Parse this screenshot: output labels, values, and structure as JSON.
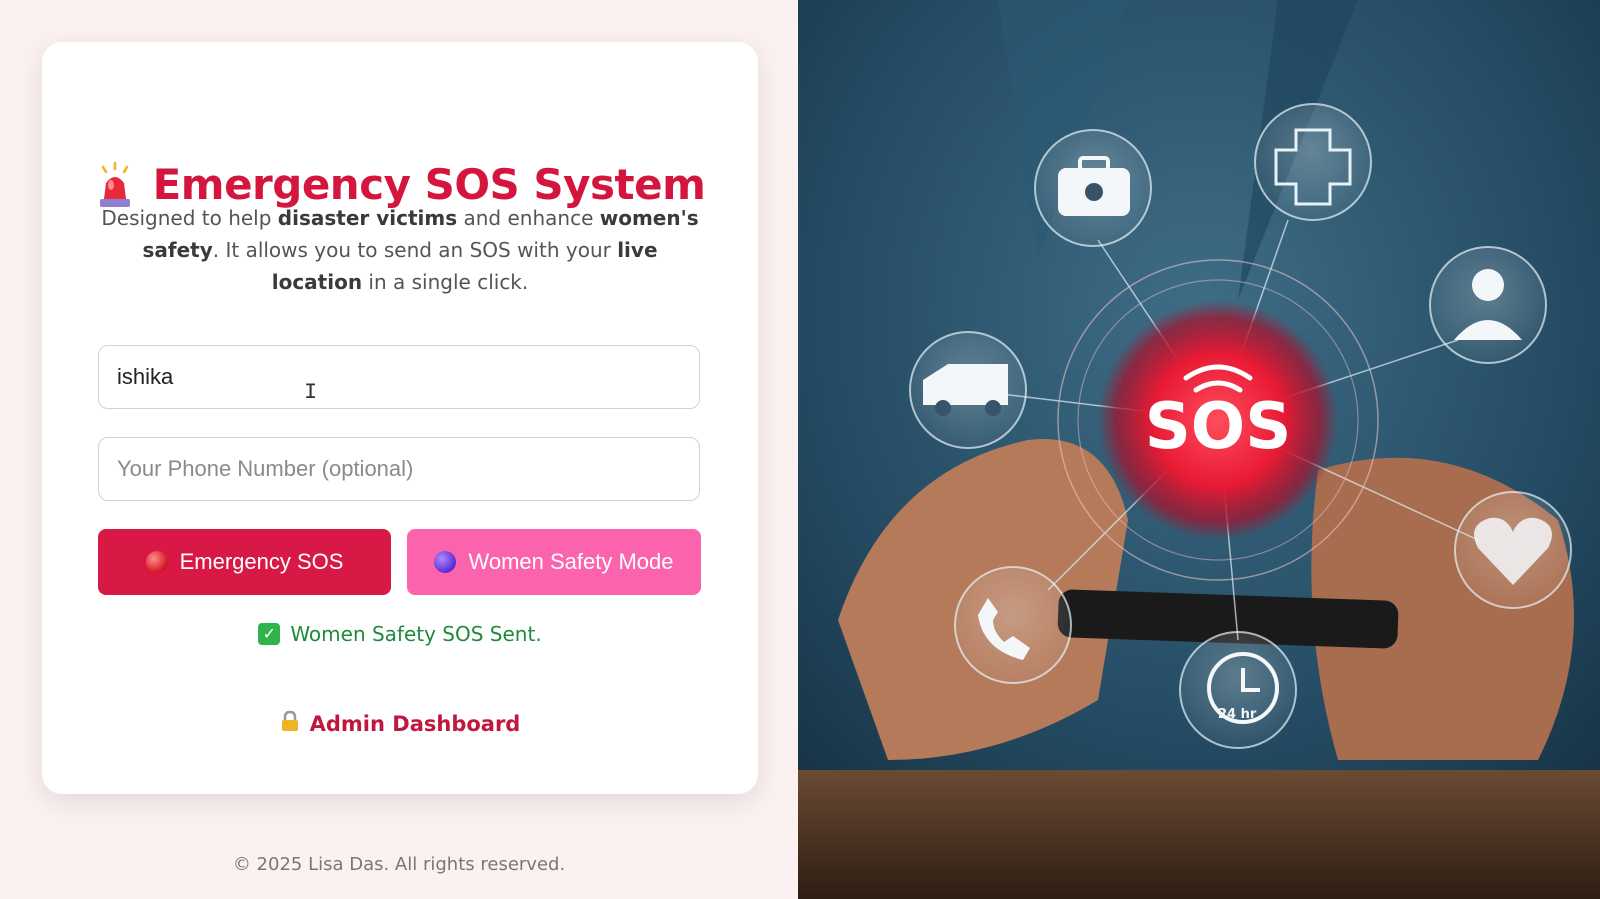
{
  "card": {
    "title": "Emergency SOS System",
    "description": {
      "p1": "Designed to help ",
      "b1": "disaster victims",
      "p2": " and enhance ",
      "b2": "women's safety",
      "p3": ". It allows you to send an SOS with your ",
      "b3": "live location",
      "p4": " in a single click."
    },
    "name_input": {
      "value": "ishika",
      "placeholder": "Your Name"
    },
    "phone_input": {
      "value": "",
      "placeholder": "Your Phone Number (optional)"
    },
    "buttons": {
      "emergency_label": "Emergency SOS",
      "women_label": "Women Safety Mode"
    },
    "status_message": "Women Safety SOS Sent.",
    "admin_link": "Admin Dashboard"
  },
  "footer": {
    "text": "© 2025 Lisa Das. All rights reserved."
  },
  "hero": {
    "badge_text": "SOS",
    "clock_label": "24 hr"
  },
  "colors": {
    "primary": "#d4163f",
    "emergency_button": "#d81845",
    "women_button": "#fb63ad",
    "success": "#1f8a3b"
  },
  "icons": {
    "title": "alarm-siren-icon",
    "emergency": "red-circle-icon",
    "women": "purple-circle-icon",
    "status": "check-mark-icon",
    "admin": "lock-icon"
  }
}
